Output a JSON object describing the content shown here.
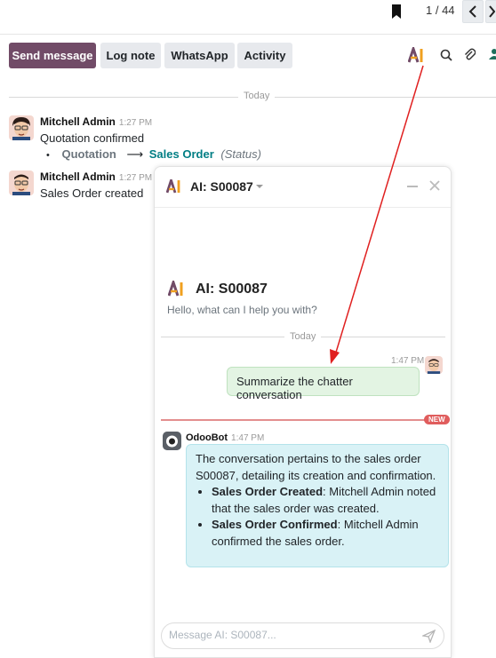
{
  "pager": {
    "text": "1 / 44"
  },
  "toolbar": {
    "send_message": "Send message",
    "log_note": "Log note",
    "whatsapp": "WhatsApp",
    "activity": "Activity"
  },
  "chatter": {
    "separator": "Today",
    "messages": [
      {
        "author": "Mitchell Admin",
        "time": "1:27 PM",
        "text": "Quotation confirmed",
        "tracking": {
          "from": "Quotation",
          "to": "Sales Order",
          "field": "(Status)"
        }
      },
      {
        "author": "Mitchell Admin",
        "time": "1:27 PM",
        "text": "Sales Order created"
      }
    ]
  },
  "ai_chat": {
    "header_title": "AI: S00087",
    "intro_title": "AI: S00087",
    "intro_subtitle": "Hello, what can I help you with?",
    "separator": "Today",
    "user_time": "1:47 PM",
    "user_message": "Summarize the chatter conversation",
    "new_badge": "NEW",
    "bot_name": "OdooBot",
    "bot_time": "1:47 PM",
    "bot_intro": "The conversation pertains to the sales order S00087, detailing its creation and confirmation.",
    "bot_points": [
      {
        "title": "Sales Order Created",
        "text": ": Mitchell Admin noted that the sales order was created."
      },
      {
        "title": "Sales Order Confirmed",
        "text": ": Mitchell Admin confirmed the sales order."
      }
    ],
    "composer_placeholder": "Message AI: S00087..."
  },
  "colors": {
    "primary": "#714b67",
    "tracking_link": "#017e84",
    "arrow": "#e02020",
    "ai_logo_purple": "#714b67",
    "ai_logo_orange": "#f0a020"
  }
}
